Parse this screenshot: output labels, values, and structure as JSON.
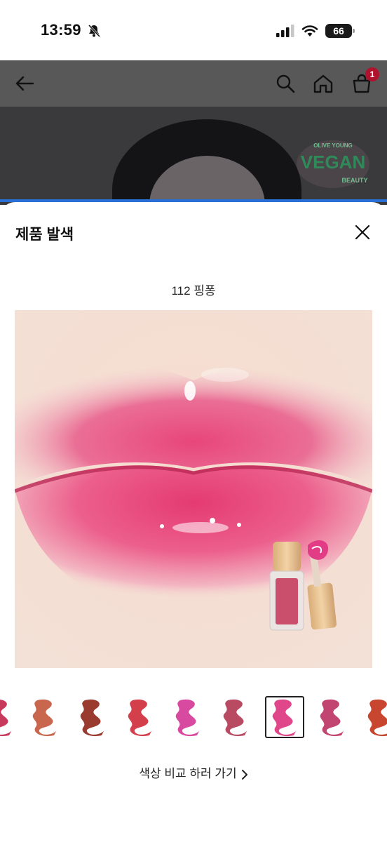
{
  "status_bar": {
    "time": "13:59",
    "battery": "66",
    "icons": [
      "bell-muted-icon",
      "signal-icon",
      "wifi-icon",
      "battery-icon"
    ]
  },
  "header": {
    "icons": [
      "back-arrow-icon",
      "search-icon",
      "home-icon",
      "cart-icon"
    ],
    "cart_count": "1"
  },
  "hero": {
    "badge_text_small": "OLIVE YOUNG",
    "badge_text_main": "VEGAN",
    "badge_text_sub": "BEAUTY"
  },
  "sheet": {
    "title": "제품 발색",
    "shade_name": "112 핑퐁",
    "compare_label": "색상 비교 하러 가기",
    "swatches": [
      {
        "color": "#c83a5c"
      },
      {
        "color": "#c9664e"
      },
      {
        "color": "#9a3b2f"
      },
      {
        "color": "#d43f4c"
      },
      {
        "color": "#d84aa0"
      },
      {
        "color": "#b84a62"
      },
      {
        "color": "#e0468a",
        "selected": true
      },
      {
        "color": "#c24470"
      },
      {
        "color": "#c84630"
      }
    ]
  },
  "colors": {
    "header_bg": "#585858",
    "accent_blue": "#2a6fd6",
    "badge_red": "#b0122e",
    "vegan_green": "#2f8a5a"
  }
}
